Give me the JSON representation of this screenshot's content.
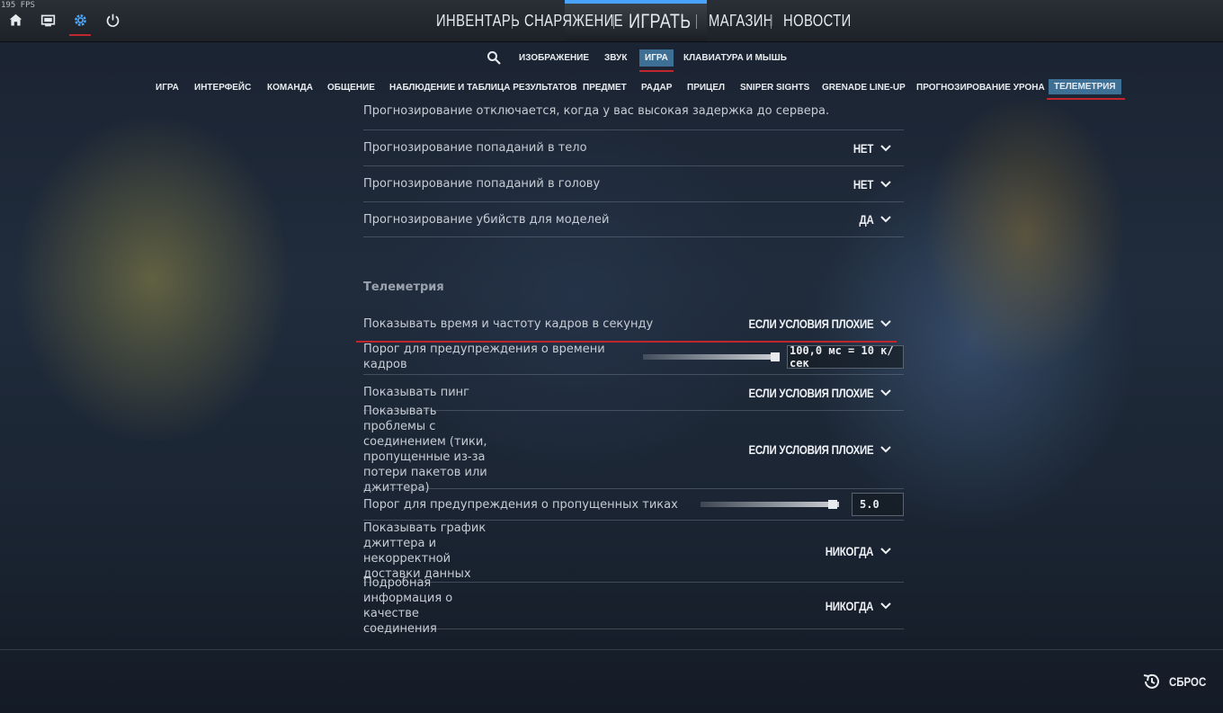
{
  "fps": "195 FPS",
  "main_nav": {
    "items": [
      "ИНВЕНТАРЬ",
      "СНАРЯЖЕНИЕ",
      "ИГРАТЬ",
      "МАГАЗИН",
      "НОВОСТИ"
    ]
  },
  "sub_nav": {
    "items": [
      "ИЗОБРАЖЕНИЕ",
      "ЗВУК",
      "ИГРА",
      "КЛАВИАТУРА И МЫШЬ"
    ],
    "active": "ИГРА"
  },
  "tabs": {
    "items": [
      "ИГРА",
      "ИНТЕРФЕЙС",
      "КОМАНДА",
      "ОБЩЕНИЕ",
      "НАБЛЮДЕНИЕ И ТАБЛИЦА РЕЗУЛЬТАТОВ",
      "ПРЕДМЕТ",
      "РАДАР",
      "ПРИЦЕЛ",
      "SNIPER SIGHTS",
      "GRENADE LINE-UP",
      "ПРОГНОЗИРОВАНИЕ УРОНА",
      "ТЕЛЕМЕТРИЯ"
    ],
    "active": "ТЕЛЕМЕТРИЯ"
  },
  "settings": {
    "fragment_text": "Прогнозирование отключается, когда у вас высокая задержка до сервера.",
    "prediction_rows": [
      {
        "label": "Прогнозирование попаданий в тело",
        "value": "НЕТ"
      },
      {
        "label": "Прогнозирование попаданий в голову",
        "value": "НЕТ"
      },
      {
        "label": "Прогнозирование убийств для моделей",
        "value": "ДА"
      }
    ],
    "telemetry_title": "Телеметрия",
    "show_frametime": {
      "label": "Показывать время и частоту кадров в секунду",
      "value": "ЕСЛИ УСЛОВИЯ ПЛОХИЕ"
    },
    "frametime_threshold": {
      "label": "Порог для предупреждения о времени кадров",
      "value": "100,0 мс = 10 к/сек",
      "level": 1.0
    },
    "show_ping": {
      "label": "Показывать пинг",
      "value": "ЕСЛИ УСЛОВИЯ ПЛОХИЕ"
    },
    "show_connection_problems": {
      "label": "Показывать проблемы с соединением (тики, пропущенные из-за потери пакетов или джиттера)",
      "value": "ЕСЛИ УСЛОВИЯ ПЛОХИЕ"
    },
    "missed_ticks_threshold": {
      "label": "Порог для предупреждения о пропущенных тиках",
      "value": "5.0",
      "level": 1.0
    },
    "show_jitter_graph": {
      "label": "Показывать график джиттера и некорректной доставки данных",
      "value": "НИКОГДА"
    },
    "connection_details": {
      "label": "Подробная информация о качестве соединения",
      "value": "НИКОГДА"
    }
  },
  "reset_label": "СБРОС"
}
